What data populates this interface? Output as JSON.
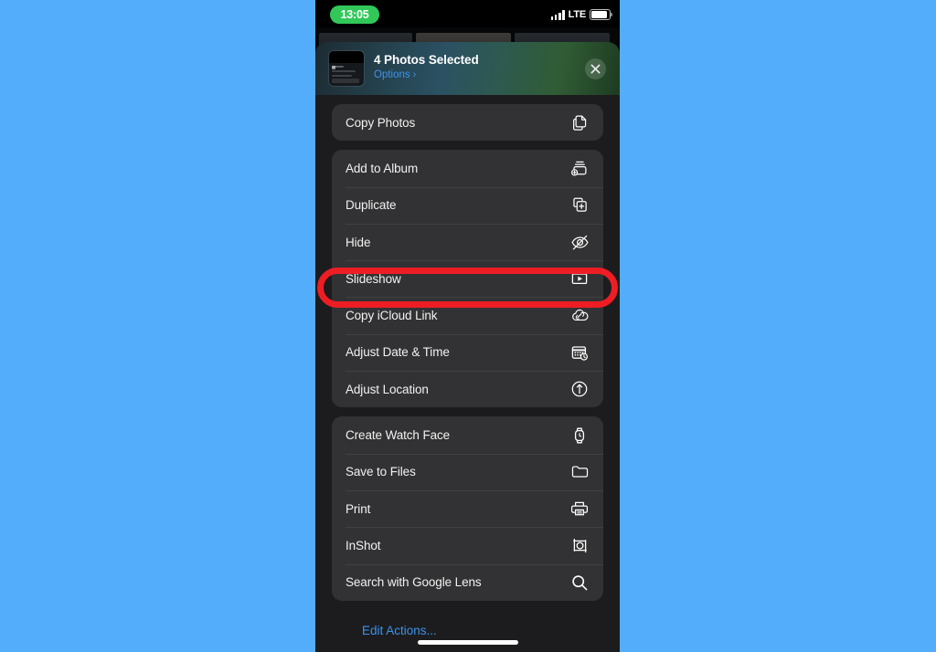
{
  "status_bar": {
    "time": "13:05",
    "time_pill_color": "#31c859",
    "network_label": "LTE",
    "signal_icon": "cellular-bars-icon",
    "battery_icon": "battery-icon"
  },
  "share_sheet": {
    "header": {
      "title": "4 Photos Selected",
      "options_label": "Options",
      "options_chevron": "›",
      "close_icon": "close-icon",
      "thumbnail_icon": "photo-thumbnail"
    },
    "groups": [
      {
        "id": "copy-group",
        "items": [
          {
            "label": "Copy Photos",
            "icon": "copy-documents-icon",
            "highlighted": false
          }
        ]
      },
      {
        "id": "library-group",
        "items": [
          {
            "label": "Add to Album",
            "icon": "album-add-icon",
            "highlighted": false
          },
          {
            "label": "Duplicate",
            "icon": "duplicate-plus-icon",
            "highlighted": false
          },
          {
            "label": "Hide",
            "icon": "eye-slash-icon",
            "highlighted": false
          },
          {
            "label": "Slideshow",
            "icon": "play-rectangle-icon",
            "highlighted": true
          },
          {
            "label": "Copy iCloud Link",
            "icon": "cloud-link-icon",
            "highlighted": false
          },
          {
            "label": "Adjust Date & Time",
            "icon": "calendar-clock-icon",
            "highlighted": false
          },
          {
            "label": "Adjust Location",
            "icon": "location-arrow-circle-icon",
            "highlighted": false
          }
        ]
      },
      {
        "id": "apps-group",
        "items": [
          {
            "label": "Create Watch Face",
            "icon": "watch-icon",
            "highlighted": false
          },
          {
            "label": "Save to Files",
            "icon": "folder-icon",
            "highlighted": false
          },
          {
            "label": "Print",
            "icon": "printer-icon",
            "highlighted": false
          },
          {
            "label": "InShot",
            "icon": "inshot-app-icon",
            "highlighted": false
          },
          {
            "label": "Search with Google Lens",
            "icon": "magnifier-icon",
            "highlighted": false
          }
        ]
      }
    ],
    "edit_actions_label": "Edit Actions...",
    "accent_color": "#3a93f0",
    "highlight_color": "#ee1d24"
  }
}
